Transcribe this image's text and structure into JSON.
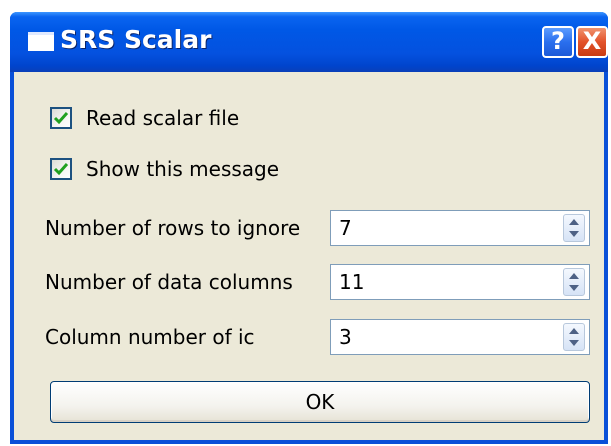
{
  "window": {
    "title": "SRS Scalar",
    "help_label": "?",
    "close_label": "X"
  },
  "options": {
    "read_scalar_file": {
      "label": "Read scalar file",
      "checked": true
    },
    "show_this_message": {
      "label": "Show this message",
      "checked": true
    }
  },
  "fields": {
    "rows_to_ignore": {
      "label": "Number of rows to ignore",
      "value": "7"
    },
    "data_columns": {
      "label": "Number of data columns",
      "value": "11"
    },
    "column_number_ic": {
      "label": "Column number of ic",
      "value": "3"
    }
  },
  "ok_button": {
    "label": "OK"
  },
  "colors": {
    "titlebar": "#0058e6",
    "dialog_background": "#ece9d8",
    "checkmark": "#21a121",
    "close_button": "#e3522a"
  }
}
